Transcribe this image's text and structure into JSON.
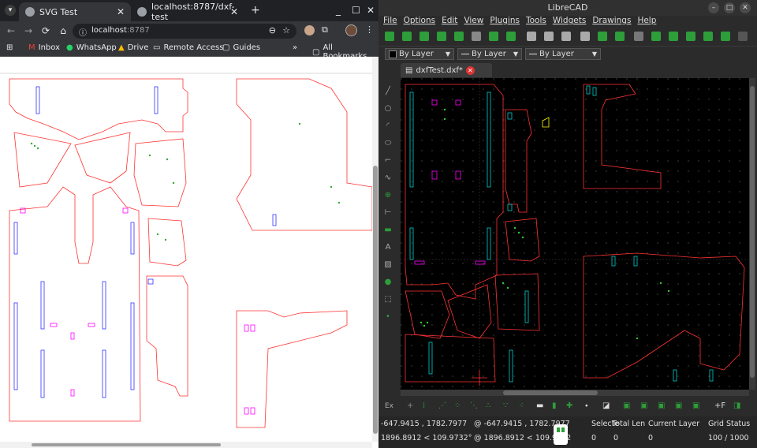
{
  "chrome": {
    "tabs": [
      {
        "title": "SVG Test",
        "active": true
      },
      {
        "title": "localhost:8787/dxf-test",
        "active": false
      }
    ],
    "new_tab_label": "+",
    "window_controls": {
      "minimize": "_",
      "maximize": "☐",
      "close": "✕"
    },
    "nav": {
      "back": "←",
      "forward": "→",
      "reload": "⟳",
      "home": "⌂"
    },
    "url_host": "localhost",
    "url_port": ":8787",
    "bookmarks": [
      {
        "label": "Inbox",
        "icon": "gmail-icon"
      },
      {
        "label": "WhatsApp",
        "icon": "whatsapp-icon"
      },
      {
        "label": "Drive",
        "icon": "drive-icon"
      },
      {
        "label": "Remote Access",
        "icon": "remote-access-icon"
      },
      {
        "label": "Guides",
        "icon": "folder-icon"
      }
    ],
    "bookmarks_overflow": "»",
    "all_bookmarks": "All Bookmarks"
  },
  "librecad": {
    "title": "LibreCAD",
    "menu": [
      "File",
      "Options",
      "Edit",
      "View",
      "Plugins",
      "Tools",
      "Widgets",
      "Drawings",
      "Help"
    ],
    "layer_selectors": [
      "By Layer",
      "By Layer",
      "By Layer"
    ],
    "doc_tab": "dxfTest.dxf*",
    "status": {
      "coord_abs": "-647.9415 , 1782.7977",
      "coord_rel": "@  -647.9415 , 1782.7977",
      "coord_polar_abs": "1896.8912 < 109.9732°",
      "coord_polar_rel": "@  1896.8912 < 109.9732",
      "selected_label": "Selecte",
      "selected_value": "0",
      "total_length_label": "Total Len",
      "total_length_value": "0",
      "current_layer_label": "Current Layer",
      "current_layer_value": "0",
      "grid_status_label": "Grid Status",
      "grid_status_value": "100 / 1000"
    },
    "colors": {
      "outline": "#ff3333",
      "blue": "#3333ff",
      "cyan": "#00cccc",
      "magenta": "#ff00ff",
      "green": "#33cc33",
      "grid": "#555555",
      "yellow": "#ffff00"
    }
  }
}
